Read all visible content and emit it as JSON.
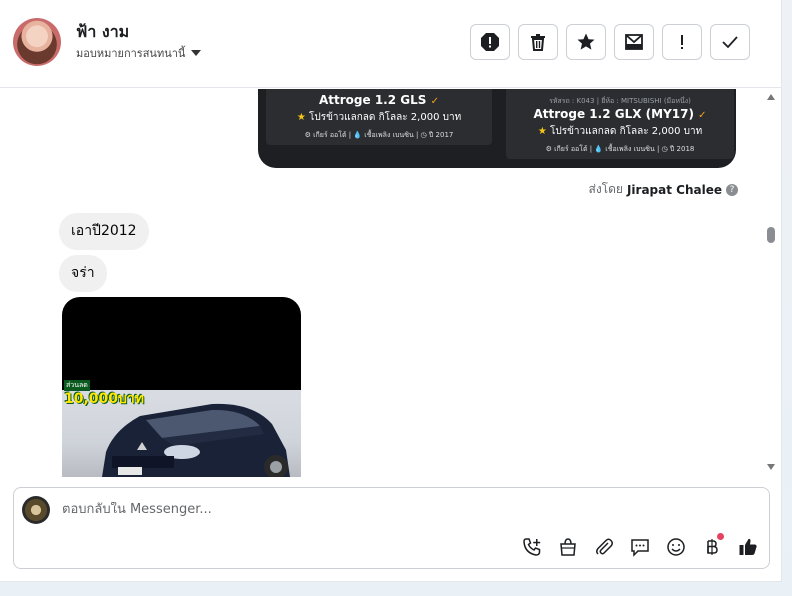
{
  "contact": {
    "name": "ฟ้า งาม",
    "assign_label": "มอบหมายการสนทนานี้"
  },
  "toolbar": {
    "buttons": [
      "spam-icon",
      "trash-icon",
      "star-icon",
      "mark-unread-icon",
      "follow-up-icon",
      "done-icon"
    ]
  },
  "conversation": {
    "cards": [
      {
        "title": "Attroge 1.2 GLS",
        "price": "โปรข้าวแลกลด กิโลละ 2,000 บาท",
        "specs": "⚙ เกียร์ ออโต้   |   💧 เชื้อเพลิง เบนซิน   |   ◷ ปี 2017"
      },
      {
        "code": "รหัสรถ : K043 | ยี่ห้อ : MITSUBISHI (มือหนึ่ง)",
        "title": "Attroge 1.2 GLX (MY17)",
        "price": "โปรข้าวแลกลด กิโลละ 2,000 บาท",
        "specs": "⚙ เกียร์ ออโต้   |   💧 เชื้อเพลิง เบนซิน   |   ◷ ปี 2018"
      }
    ],
    "sent_by_prefix": "ส่งโดย",
    "sent_by_name": "Jirapat Chalee",
    "messages": [
      {
        "text": "เอาปี2012"
      },
      {
        "text": "จร่า"
      }
    ],
    "photo_promo": "ส่วนลด",
    "photo_promo_big": "10,000บาท"
  },
  "composer": {
    "placeholder": "ตอบกลับใน Messenger...",
    "tools": [
      "call-icon",
      "bag-icon",
      "attach-icon",
      "saved-replies-icon",
      "emoji-icon",
      "baht-icon",
      "like-icon"
    ]
  },
  "colors": {
    "accent_dot": "#e4425f",
    "card_bg": "#1d1f22",
    "bubble_bg": "#f0f0f0"
  }
}
